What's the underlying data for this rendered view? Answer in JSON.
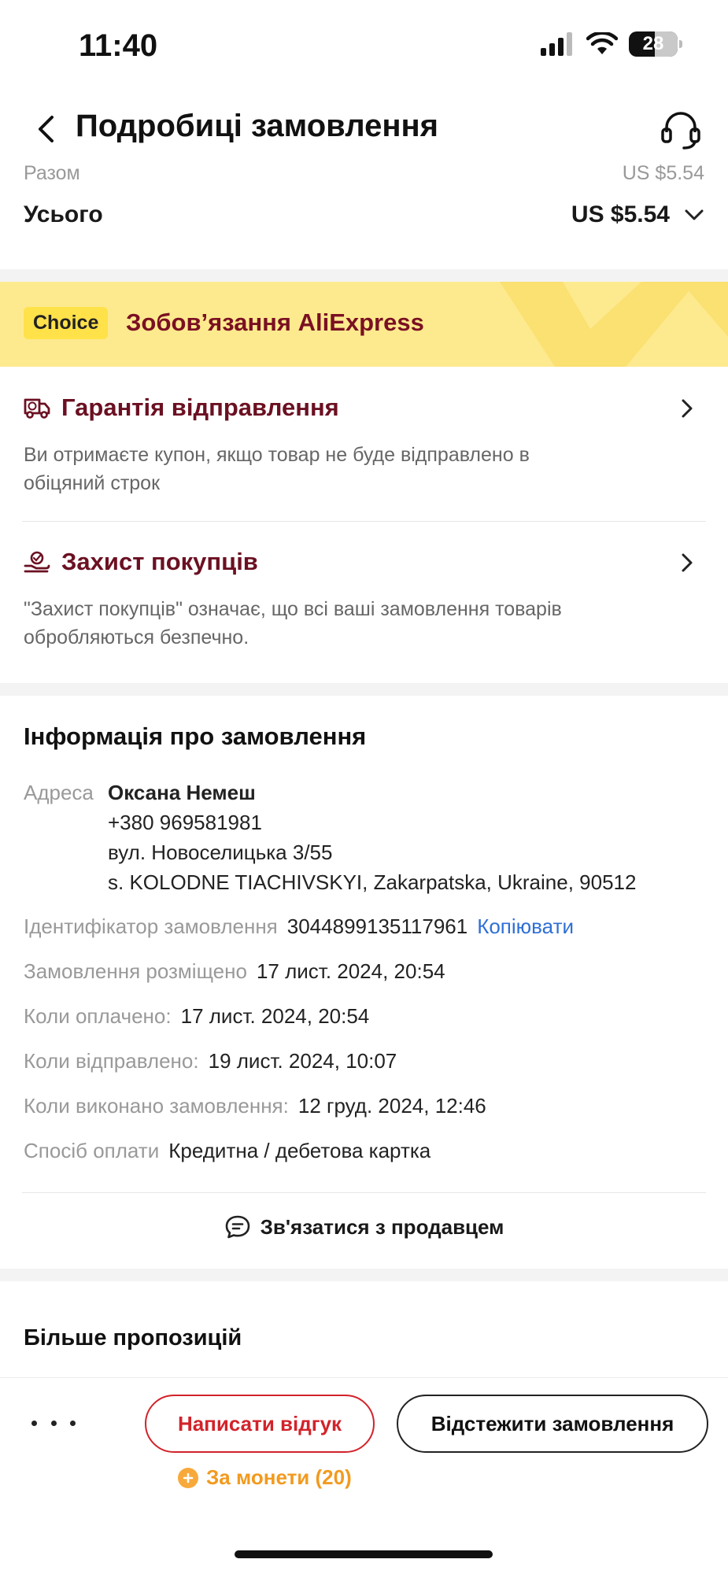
{
  "status_bar": {
    "time": "11:40",
    "battery": "28"
  },
  "header": {
    "title": "Подробиці замовлення"
  },
  "summary": {
    "partial_label": "Разом",
    "partial_value": "US $5.54",
    "total_label": "Усього",
    "total_value": "US $5.54"
  },
  "choice": {
    "badge": "Choice",
    "text": "Зобов’язання AliExpress"
  },
  "features": [
    {
      "title": "Гарантія відправлення",
      "desc_line1": "Ви отримаєте купон, якщо товар не буде відправлено в",
      "desc_line2": "обіцяний строк"
    },
    {
      "title": "Захист покупців",
      "desc_line1": "\"Захист покупців\" означає, що всі ваші замовлення товарів",
      "desc_line2": "обробляються безпечно."
    }
  ],
  "order_info": {
    "title": "Інформація про замовлення",
    "address_label": "Адреса",
    "name": "Оксана Немеш",
    "phone": "+380 969581981",
    "street": "вул. Новоселицька 3/55",
    "city": "s. KOLODNE TIACHIVSKYI, Zakarpatska, Ukraine, 90512",
    "order_id_label": "Ідентифікатор замовлення",
    "order_id": "3044899135117961",
    "copy_label": "Копіювати",
    "placed_label": "Замовлення розміщено",
    "placed_value": "17 лист. 2024, 20:54",
    "paid_label": "Коли оплачено:",
    "paid_value": "17 лист. 2024, 20:54",
    "shipped_label": "Коли відправлено:",
    "shipped_value": "19 лист. 2024, 10:07",
    "completed_label": "Коли виконано замовлення:",
    "completed_value": "12 груд. 2024, 12:46",
    "payment_label": "Спосіб оплати",
    "payment_value": "Кредитна / дебетова картка",
    "contact_seller": "Зв'язатися з продавцем"
  },
  "more_offers": {
    "title": "Більше пропозицій"
  },
  "bottom_bar": {
    "review_button": "Написати відгук",
    "track_button": "Відстежити замовлення",
    "coins_label": "За монети (20)"
  },
  "colors": {
    "accent_red": "#d2232a",
    "feature_title": "#6b1022",
    "choice_bg": "#fdea8e",
    "link_blue": "#2f6fd6",
    "coins_orange": "#f29a1f"
  }
}
